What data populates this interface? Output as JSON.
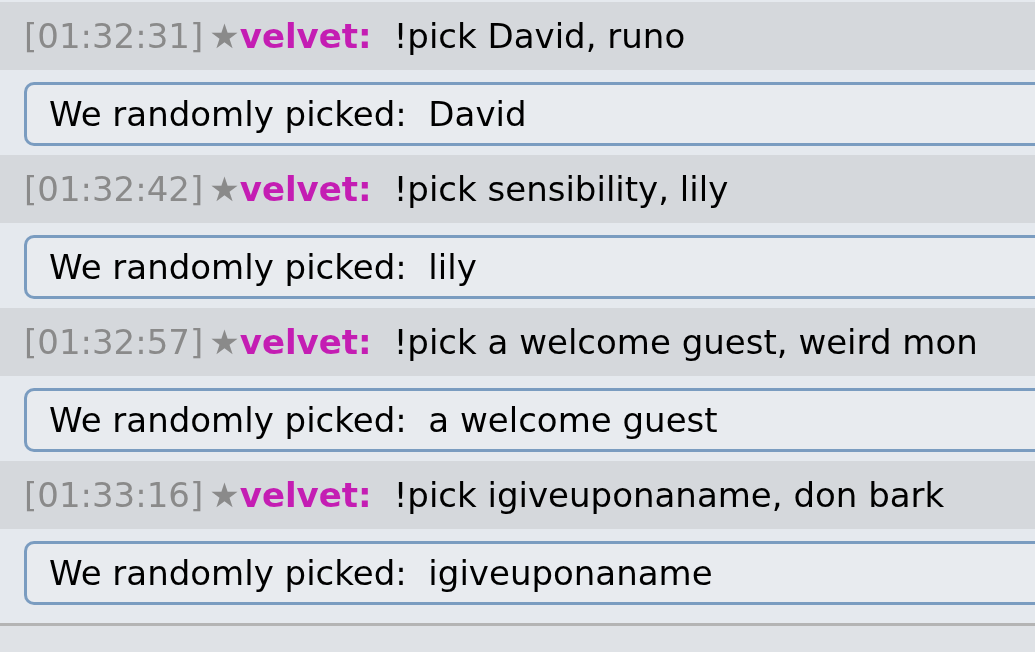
{
  "messages": [
    {
      "time": "[01:32:31]",
      "rank": "★",
      "user": "velvet:",
      "text": "!pick David, runo",
      "reply": "We randomly picked:  David"
    },
    {
      "time": "[01:32:42]",
      "rank": "★",
      "user": "velvet:",
      "text": "!pick sensibility, lily",
      "reply": "We randomly picked:  lily"
    },
    {
      "time": "[01:32:57]",
      "rank": "★",
      "user": "velvet:",
      "text": "!pick a welcome guest, weird mon",
      "reply": "We randomly picked:  a welcome guest"
    },
    {
      "time": "[01:33:16]",
      "rank": "★",
      "user": "velvet:",
      "text": "!pick igiveuponaname, don bark",
      "reply": "We randomly picked:  igiveuponaname"
    }
  ]
}
